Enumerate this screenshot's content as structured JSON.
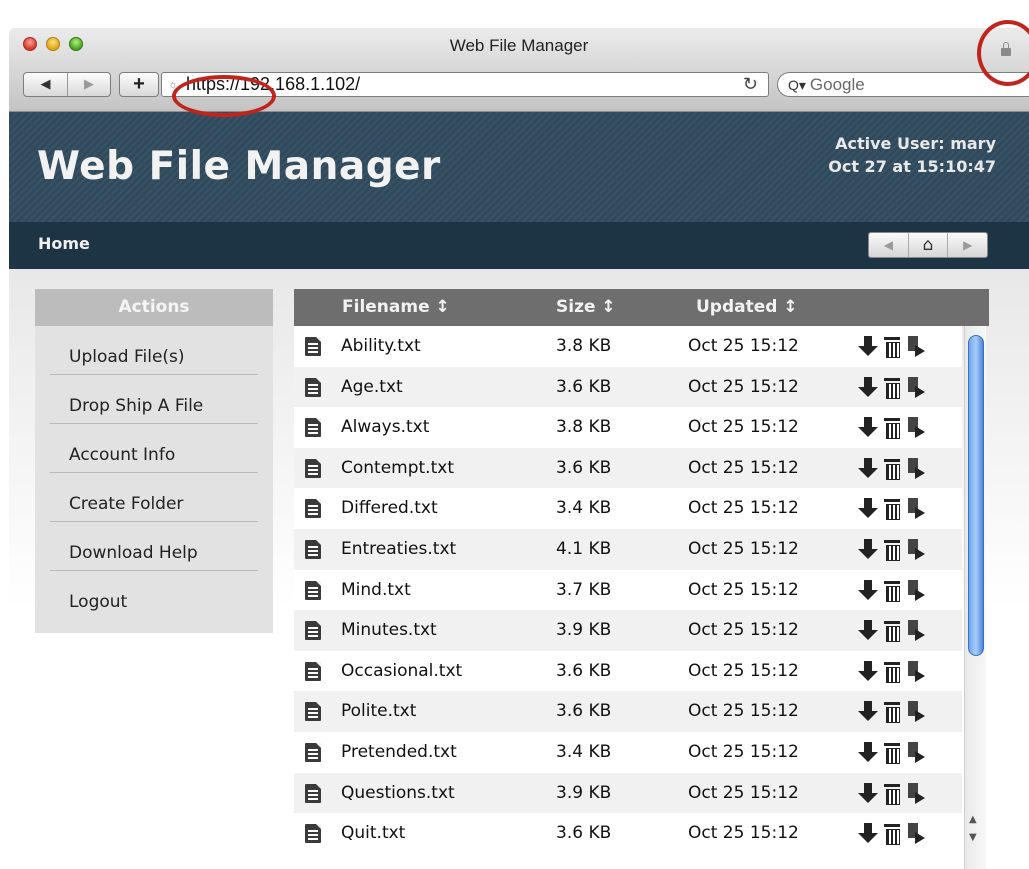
{
  "browser": {
    "window_title": "Web File Manager",
    "url": "https://192.168.1.102/",
    "search_placeholder": "Google",
    "icons": [
      "close-icon",
      "minimize-icon",
      "maximize-icon",
      "back-icon",
      "forward-icon",
      "add-icon",
      "reload-icon",
      "search-icon",
      "lock-icon"
    ]
  },
  "header": {
    "title": "Web File Manager",
    "active_user": "Active User: mary",
    "datetime": "Oct 27 at 15:10:47"
  },
  "nav": {
    "home": "Home"
  },
  "sidebar": {
    "heading": "Actions",
    "items": [
      "Upload File(s)",
      "Drop Ship A File",
      "Account Info",
      "Create Folder",
      "Download Help",
      "Logout"
    ]
  },
  "table": {
    "columns": [
      "Filename ↕",
      "Size ↕",
      "Updated ↕"
    ],
    "rows": [
      {
        "name": "Ability.txt",
        "size": "3.8 KB",
        "updated": "Oct 25 15:12"
      },
      {
        "name": "Age.txt",
        "size": "3.6 KB",
        "updated": "Oct 25 15:12"
      },
      {
        "name": "Always.txt",
        "size": "3.8 KB",
        "updated": "Oct 25 15:12"
      },
      {
        "name": "Contempt.txt",
        "size": "3.6 KB",
        "updated": "Oct 25 15:12"
      },
      {
        "name": "Differed.txt",
        "size": "3.4 KB",
        "updated": "Oct 25 15:12"
      },
      {
        "name": "Entreaties.txt",
        "size": "4.1 KB",
        "updated": "Oct 25 15:12"
      },
      {
        "name": "Mind.txt",
        "size": "3.7 KB",
        "updated": "Oct 25 15:12"
      },
      {
        "name": "Minutes.txt",
        "size": "3.9 KB",
        "updated": "Oct 25 15:12"
      },
      {
        "name": "Occasional.txt",
        "size": "3.6 KB",
        "updated": "Oct 25 15:12"
      },
      {
        "name": "Polite.txt",
        "size": "3.6 KB",
        "updated": "Oct 25 15:12"
      },
      {
        "name": "Pretended.txt",
        "size": "3.4 KB",
        "updated": "Oct 25 15:12"
      },
      {
        "name": "Questions.txt",
        "size": "3.9 KB",
        "updated": "Oct 25 15:12"
      },
      {
        "name": "Quit.txt",
        "size": "3.6 KB",
        "updated": "Oct 25 15:12"
      }
    ],
    "row_icons": [
      "file-icon",
      "download-icon",
      "trash-icon",
      "move-icon"
    ]
  },
  "colors": {
    "header_bg": "#2f4a5c",
    "nav_bg": "#1d3445",
    "annotation": "#c0241b"
  }
}
